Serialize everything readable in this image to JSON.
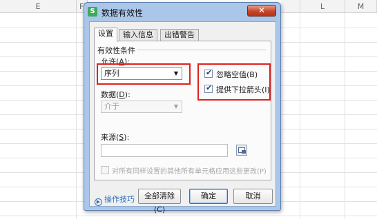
{
  "spreadsheet": {
    "columns": [
      "E",
      "F",
      "L",
      "M"
    ]
  },
  "dialog": {
    "app_icon": "S",
    "title": "数据有效性",
    "close_glyph": "✕",
    "tabs": [
      {
        "label": "设置",
        "active": true
      },
      {
        "label": "输入信息",
        "active": false
      },
      {
        "label": "出错警告",
        "active": false
      }
    ],
    "settings": {
      "group_label": "有效性条件",
      "allow_label": "允许(A):",
      "allow_label_text": "允许(",
      "allow_label_key": "A",
      "allow_label_tail": "):",
      "allow_value": "序列",
      "data_label_text": "数据(",
      "data_label_key": "D",
      "data_label_tail": "):",
      "data_value": "介于",
      "ignore_blank_label": "忽略空值(B)",
      "ignore_blank_checked": true,
      "dropdown_label": "提供下拉箭头(I)",
      "dropdown_checked": true,
      "source_label_text": "来源(",
      "source_label_key": "S",
      "source_label_tail": "):",
      "source_value": "",
      "apply_all_label": "对所有同样设置的其他所有单元格应用这些更改(P)",
      "apply_all_checked": false
    },
    "footer": {
      "tips_label": "操作技巧",
      "clear_all_label": "全部清除(C)",
      "ok_label": "确定",
      "cancel_label": "取消"
    },
    "highlight_color": "#e0201e"
  }
}
